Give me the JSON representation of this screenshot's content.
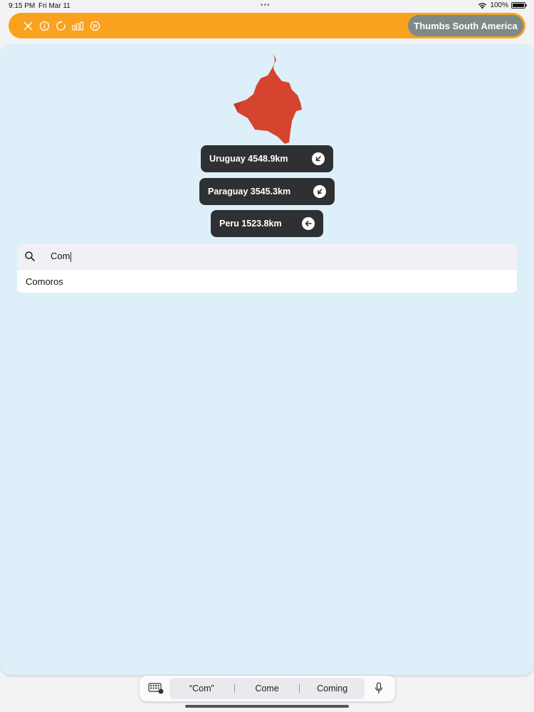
{
  "status_bar": {
    "time": "9:15 PM",
    "date": "Fri Mar 11",
    "dots": "•••",
    "battery_label": "100%"
  },
  "toolbar": {
    "icons": [
      "close-icon",
      "info-icon",
      "restart-icon",
      "stats-icon",
      "pause-icon"
    ],
    "mode_button_label": "Thumbs South America",
    "color": "#f9a21f"
  },
  "target_shape": {
    "fill": "#d6432f",
    "icon": "country-silhouette"
  },
  "guesses": [
    {
      "country": "Uruguay",
      "distance": "4548.9km",
      "label": "Uruguay  4548.9km",
      "direction": "southwest"
    },
    {
      "country": "Paraguay",
      "distance": "3545.3km",
      "label": "Paraguay  3545.3km",
      "direction": "southwest"
    },
    {
      "country": "Peru",
      "distance": "1523.8km",
      "label": "Peru  1523.8km",
      "direction": "west"
    }
  ],
  "search": {
    "value": "Com"
  },
  "suggestions": [
    "Comoros"
  ],
  "keyboard_bar": {
    "predictions": [
      "“Com”",
      "Come",
      "Coming"
    ]
  },
  "colors": {
    "background": "#ddeff8",
    "guess_pill": "#2f3033",
    "mode_button": "#7f8a88"
  }
}
